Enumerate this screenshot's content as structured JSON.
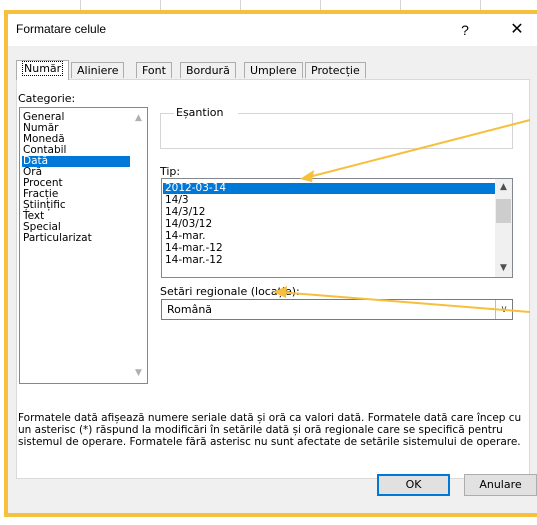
{
  "dialog": {
    "title": "Formatare celule",
    "help_label": "?",
    "close_label": "✕"
  },
  "tabs": [
    {
      "label": "Număr",
      "active": true
    },
    {
      "label": "Aliniere"
    },
    {
      "label": "Font"
    },
    {
      "label": "Bordură"
    },
    {
      "label": "Umplere"
    },
    {
      "label": "Protecție"
    }
  ],
  "category": {
    "label": "Categorie:",
    "items": [
      "General",
      "Număr",
      "Monedă",
      "Contabil",
      "Dată",
      "Oră",
      "Procent",
      "Fracție",
      "Științific",
      "Text",
      "Special",
      "Particularizat"
    ],
    "selected": "Dată"
  },
  "sample": {
    "label": "Eșantion"
  },
  "type": {
    "label": "Tip:",
    "items": [
      "2012-03-14",
      "14/3",
      "14/3/12",
      "14/03/12",
      "14-mar.",
      "14-mar.-12",
      "14-mar.-12"
    ],
    "selected": "2012-03-14"
  },
  "locale": {
    "label": "Setări regionale (locație):",
    "value": "Română"
  },
  "description": "Formatele dată afișează numere seriale dată și oră ca valori dată. Formatele dată care încep cu un asterisc (*) răspund la modificări în setările dată și oră regionale care se specifică pentru sistemul de operare. Formatele fără asterisc nu sunt afectate de setările sistemului de operare.",
  "buttons": {
    "ok": "OK",
    "cancel": "Anulare"
  },
  "colors": {
    "accent": "#0078d7",
    "annotation": "#f6bf3c"
  },
  "icons": [
    "help-icon",
    "close-icon",
    "chevron-up-icon",
    "chevron-down-icon"
  ]
}
